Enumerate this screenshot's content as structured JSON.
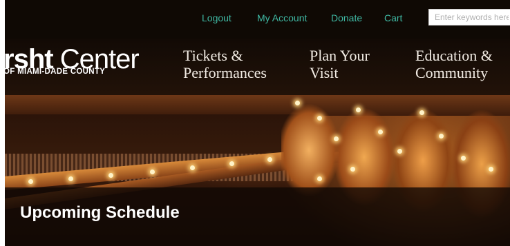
{
  "header": {
    "links": [
      {
        "label": "Logout"
      },
      {
        "label": "My Account"
      },
      {
        "label": "Donate"
      },
      {
        "label": "Cart"
      }
    ],
    "search": {
      "placeholder": "Enter keywords here"
    }
  },
  "logo": {
    "bold_part": "rsht",
    "light_part": " Center",
    "subtitle": "OF MIAMI-DADE COUNTY"
  },
  "nav": {
    "items": [
      {
        "label": "Tickets &\nPerformances"
      },
      {
        "label": "Plan Your\nVisit"
      },
      {
        "label": "Education &\nCommunity"
      }
    ]
  },
  "hero": {
    "title": "Upcoming Schedule"
  },
  "colors": {
    "utility_link": "#3fb8a3",
    "nav_text": "#f2ece4",
    "background": "#0f0904"
  }
}
